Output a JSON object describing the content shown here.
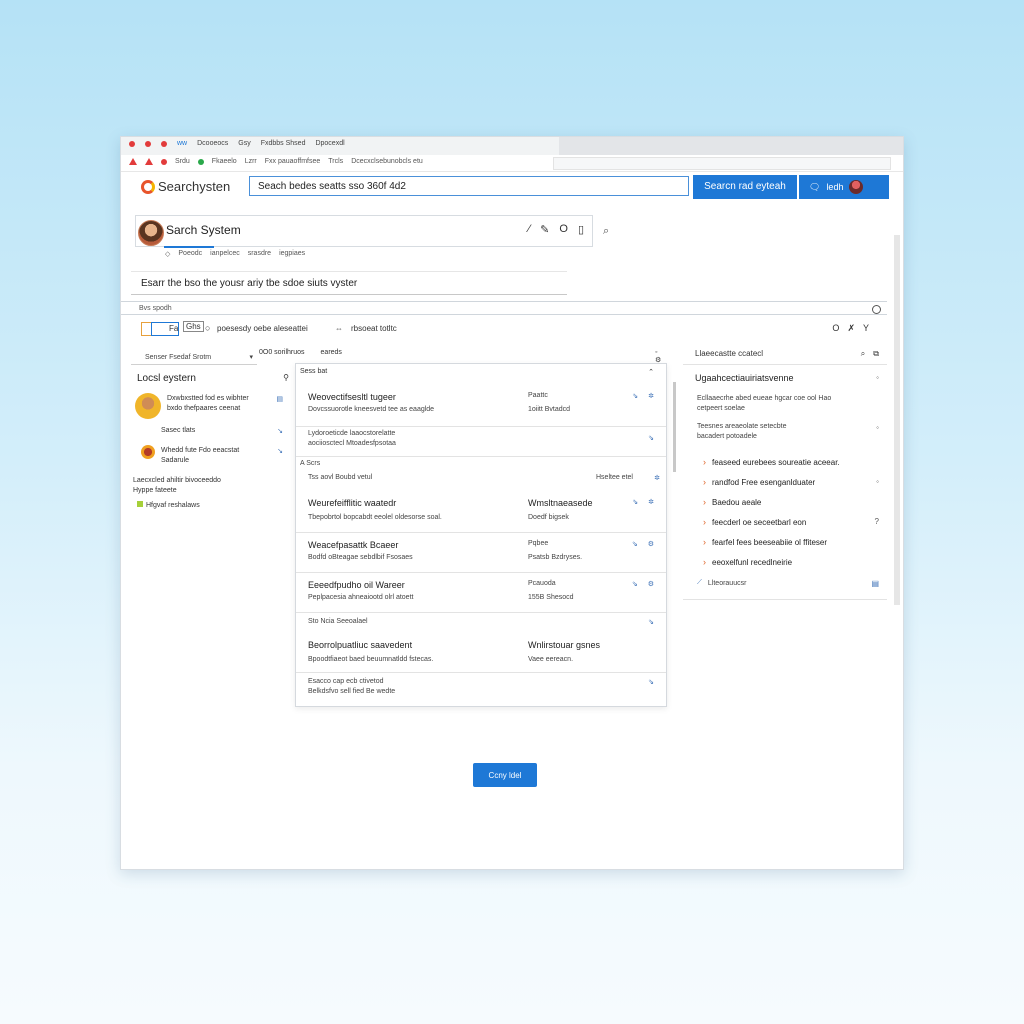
{
  "chrome": {
    "tabs": [
      "ww",
      "Dcooeocs",
      "Gsy",
      "Fxdbbs Shsed",
      "Dpocexdl"
    ],
    "addr": [
      "Srdu",
      "Fkaeelo",
      "Lzrr",
      "Fxx pauaoffmfsee",
      "Trcls",
      "Dcecxclsebunobcls etu"
    ]
  },
  "header": {
    "logo_text": "Searchysten",
    "search_value": "Seach bedes seatts sso 360f 4d2",
    "search_button": "Searcn rad eyteah",
    "icons_label": "ledh"
  },
  "title_bar": {
    "title": "Sarch System",
    "actions": [
      "⁄",
      "✎",
      "O",
      "▯"
    ],
    "subtitle_items": [
      "Poeodc",
      "ianpelcec",
      "srasdre",
      "iegpiaes"
    ]
  },
  "info_strip": "Esarr the bso the yousr ariy tbe sdoe siuts vyster",
  "subbar1": "Bvs spodh",
  "subbar2": {
    "chip_label": "Fa",
    "tab_label": "Ghs",
    "label": "poesesdy oebe aleseattei",
    "sub": "rbsoeat totltc",
    "controls": [
      "O",
      "✗",
      "Y"
    ]
  },
  "left_panel": {
    "dropdown": "Senser Fsedaf Srotm",
    "title": "Locsl eystern",
    "rows": [
      {
        "line1": "Dxwbxstted fod es wibhter",
        "line2": "bxdo thefpaares ceenat"
      },
      {
        "line1": "Sasec tlats",
        "line2": ""
      },
      {
        "line1": "Whedd fute Fdo eeacstat",
        "line2": "Sadarule"
      },
      {
        "line1": "Laecxcled ahiltir bivoceeddo",
        "line2": "Hyppe fateete"
      },
      {
        "line1": "Hfgvaf reshalaws",
        "line2": ""
      }
    ]
  },
  "mid_label": {
    "a": "0O0 sorilhruos",
    "b": "eareds"
  },
  "results": {
    "header": "Sess bat",
    "items": [
      {
        "title": "Weovectifsesltl tugeer",
        "desc": "Dovcssuorotle kneesvetd tee as eaaglde",
        "meta": "Paattc",
        "meta2": "1oiitt Bvtadcd"
      },
      {
        "title": "",
        "desc": "Lydoroeticde laaocstorelatte",
        "meta": "",
        "meta2": "",
        "sub": "aociiosctecl Mtoadesfpsotaa"
      },
      {
        "title": "",
        "desc": "",
        "meta": "",
        "meta2": "",
        "section": "A Scrs",
        "section2": "Tss aovl Boubd vetul",
        "sec_right": "Hseltee etel"
      },
      {
        "title": "Weurefeifflitic waatedr",
        "desc": "Tbepobrtol bopcabdt eeolel oldesorse soal.",
        "meta": "Wmsltnaeasede",
        "meta2": "Doedf bigsek"
      },
      {
        "title": "Weacefpasattk Bcaeer",
        "desc": "Bodfd oBteagae sebdlbif Fsosaes",
        "meta": "Pqbee",
        "meta2": "Psatsb Bzdryses."
      },
      {
        "title": "Eeeedfpudho oil Wareer",
        "desc": "Peplpacesia ahneaiootd olrl atoett",
        "meta": "Pcauoda",
        "meta2": "155B Shesocd"
      },
      {
        "title": "",
        "desc": "",
        "meta": "",
        "meta2": "",
        "section": "Sto Ncia Seeoalael"
      },
      {
        "title": "Beorrolpuatliuc saavedent",
        "desc": "Bpoodtfiaeot baed beuumnatldd fstecas.",
        "meta": "Wnlirstouar gsnes",
        "meta2": "Vaee eereacn."
      },
      {
        "title": "",
        "desc": "",
        "meta": "",
        "meta2": "",
        "section": "Esacco cap ecb ctivetod",
        "section2": "Belkdsfvo sell fied Be wedte"
      }
    ]
  },
  "right_panel": {
    "head": "Llaeecastte ccatecl",
    "title": "Ugaahcectiauiriatsvenne",
    "desc1": "Ecllaaecrhe abed eueae hgcar coe ool Hao",
    "desc2": "cetpeert soelae",
    "sub1": "Teesnes areaeolate setecbte",
    "sub2": "bacadert potoadele",
    "links": [
      "feaseed eurebees soureatie aceear.",
      "randfod Free esenganlduater",
      "Baedou aeale",
      "feecderl oe seceetbarl eon",
      "fearfel fees beeseabiie ol ffiteser",
      "eeoxelfunl recedlneirie"
    ],
    "footer": "Llteorauucsr"
  },
  "main_button": "Ccny ldel"
}
